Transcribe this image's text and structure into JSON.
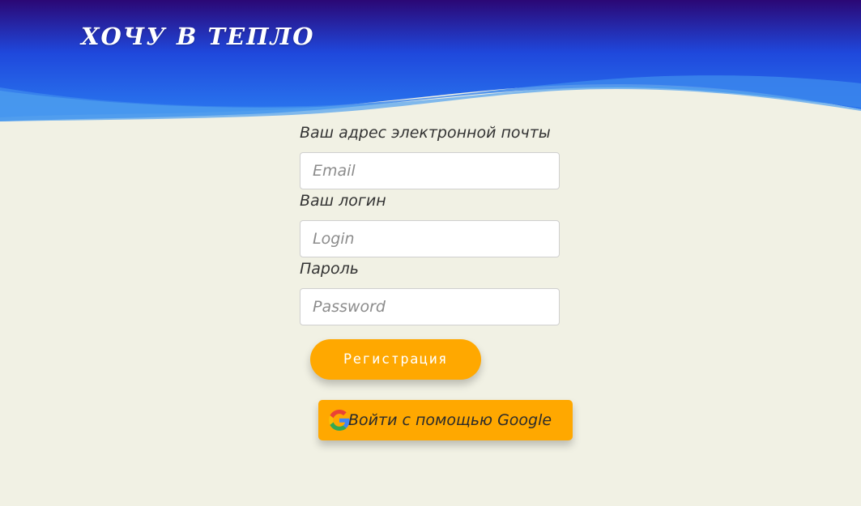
{
  "header": {
    "brand": "ХОЧУ В ТЕПЛО",
    "colors": {
      "top": "#2a0a7a",
      "mid": "#1c4fe0",
      "bottom": "#3f92ea"
    }
  },
  "form": {
    "email_label": "Ваш адрес электронной почты",
    "email_placeholder": "Email",
    "login_label": "Ваш логин",
    "login_placeholder": "Login",
    "password_label": "Пароль",
    "password_placeholder": "Password",
    "register_label": "Регистрация",
    "google_label": "Войти с помощью Google",
    "google_icon": "google-icon"
  },
  "colors": {
    "background": "#f1f1e4",
    "button": "#ffa800"
  }
}
